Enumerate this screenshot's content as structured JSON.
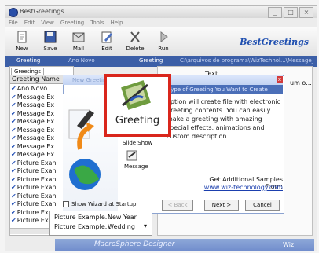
{
  "app": {
    "title": "BestGreetings",
    "brand": "BestGreetings"
  },
  "menu": [
    "File",
    "Edit",
    "View",
    "Greeting",
    "Tools",
    "Help"
  ],
  "toolbar": [
    {
      "label": "New",
      "icon": "new-icon"
    },
    {
      "label": "Save",
      "icon": "save-icon"
    },
    {
      "label": "Mail",
      "icon": "mail-icon"
    },
    {
      "label": "Edit",
      "icon": "edit-icon"
    },
    {
      "label": "Delete",
      "icon": "delete-icon"
    },
    {
      "label": "Run",
      "icon": "run-icon"
    }
  ],
  "address": {
    "left": "Greeting",
    "mid": "Ano Novo",
    "label": "Greeting",
    "path": "C:\\arquivos de programa\\WizTechnol...\\Message_02.dg"
  },
  "left_panel": {
    "tab": "Greetings",
    "header": "Greeting Name",
    "items": [
      "Ano Novo",
      "Message Ex",
      "Message Ex",
      "Message Ex",
      "Message Ex",
      "Message Ex",
      "Message Ex",
      "Message Ex",
      "Message Ex",
      "Picture Exan",
      "Picture Exan",
      "Picture Exan",
      "Picture Exan",
      "Picture Exan",
      "Picture Exan",
      "Picture Exan",
      "Picture Exan"
    ]
  },
  "right_panel": {
    "col1": "Text",
    "col2": "um o..."
  },
  "wizard": {
    "title": "New Greeting Wizard",
    "banner": "Type of Greeting You Want to Create",
    "close": "x",
    "description": "option will create file with electronic greeting contents. You can easily make a greeting with amazing special effects, animations and custom description.",
    "greeting_label": "Greeting",
    "slideshow_label": "Slide Show",
    "message_label": "Message",
    "additional": "Get Additional Samples From:",
    "link": "www.wiz-technology.com",
    "show_wizard": "Show Wizard at Startup",
    "back": "< Back",
    "next": "Next >",
    "cancel": "Cancel"
  },
  "dropdown": [
    {
      "name": "Picture Example...",
      "value": "New Year"
    },
    {
      "name": "Picture Example...",
      "value": "Wedding"
    }
  ],
  "bottom": {
    "text": "MacroSphere Designer",
    "right": "Wiz"
  },
  "colors": {
    "accent": "#d9261c",
    "titlebar": "#3c5fa7",
    "link": "#1b3fae"
  }
}
